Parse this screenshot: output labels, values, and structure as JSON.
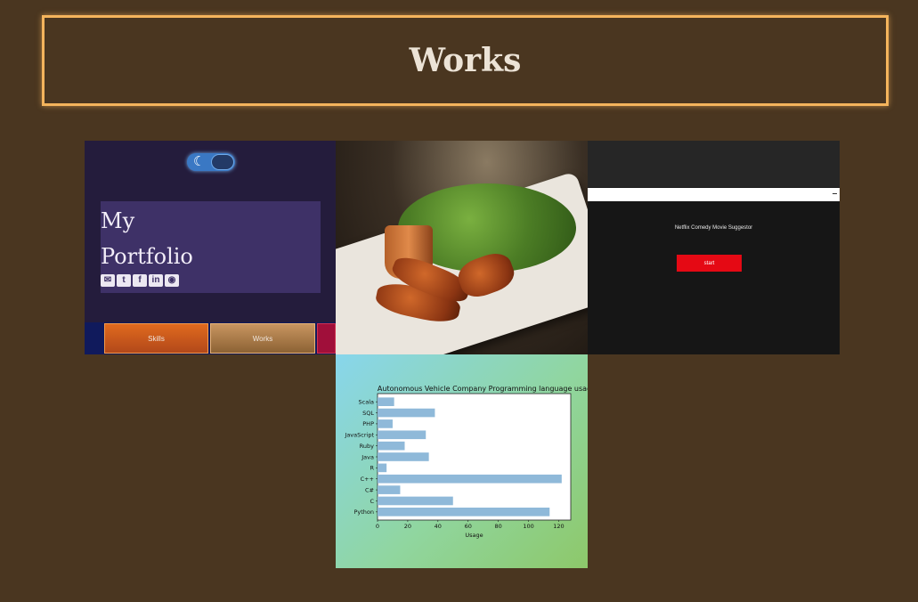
{
  "header": {
    "title": "Works"
  },
  "portfolio_tile": {
    "toggle_icon": "moon-icon",
    "title_line1": "My",
    "title_line2": "Portfolio",
    "social_icons": [
      "mail-icon",
      "twitter-icon",
      "facebook-icon",
      "linkedin-icon",
      "github-icon"
    ],
    "nav": {
      "skills": "Skills",
      "works": "Works"
    }
  },
  "netflix_tile": {
    "title": "Netflix Comedy Movie Suggestor",
    "start_label": "start",
    "accent": "#e50914"
  },
  "chart_data": {
    "type": "bar",
    "orientation": "horizontal",
    "title": "Autonomous Vehicle Company Programming language usage",
    "xlabel": "Usage",
    "ylabel": "",
    "categories": [
      "Python",
      "C",
      "C#",
      "C++",
      "R",
      "Java",
      "Ruby",
      "JavaScript",
      "PHP",
      "SQL",
      "Scala"
    ],
    "values": [
      114,
      50,
      15,
      122,
      6,
      34,
      18,
      32,
      10,
      38,
      11
    ],
    "xlim": [
      0,
      128
    ],
    "xticks": [
      0,
      20,
      40,
      60,
      80,
      100,
      120
    ],
    "bar_color": "#8fb9d9",
    "grid": false
  }
}
